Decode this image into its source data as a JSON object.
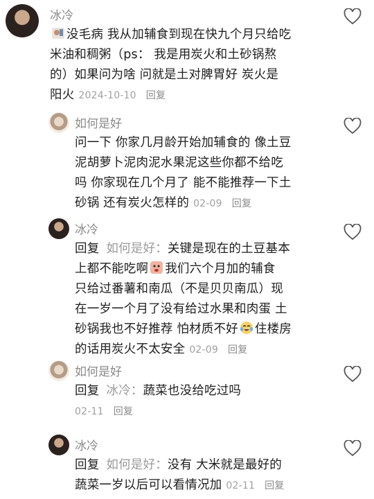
{
  "comments": [
    {
      "user": "冰冷",
      "lines": [
        "没毛病 我从加辅食到现在快九个月只给吃",
        "米油和稠粥（ps： 我是用炭火和土砂锅熬",
        "的）如果问为啥 问就是土对脾胃好 炭火是",
        "阳火"
      ],
      "date": "2024-10-10",
      "reply_label": "回复"
    },
    {
      "user": "如何是好",
      "lines": [
        "问一下 你家几月龄开始加辅食的 像土豆",
        "泥胡萝卜泥肉泥水果泥这些你都不给吃",
        "吗 你家现在几个月了 能不能推荐一下土",
        "砂锅 还有炭火怎样的"
      ],
      "date": "02-09",
      "reply_label": "回复"
    },
    {
      "user": "冰冷",
      "reply_prefix": "回复",
      "mention": "如何是好：",
      "lines": [
        "关键是现在的土豆基本",
        "上都不能吃啊",
        "我们六个月加的辅食",
        "只给过番薯和南瓜（不是贝贝南瓜）现",
        "在一岁一个月了没有给过水果和肉蛋 土",
        "砂锅我也不好推荐 怕材质不好",
        "住楼房",
        "的话用炭火不太安全"
      ],
      "date": "02-09",
      "reply_label": "回复"
    },
    {
      "user": "如何是好",
      "reply_prefix": "回复",
      "mention": "冰冷：",
      "lines": [
        "蔬菜也没给吃过吗"
      ],
      "date": "02-11",
      "reply_label": "回复"
    },
    {
      "user": "冰冷",
      "reply_prefix": "回复",
      "mention": "如何是好：",
      "lines": [
        "没有 大米就是最好的",
        "蔬菜一岁以后可以看情况加"
      ],
      "date": "02-11",
      "reply_label": "回复"
    }
  ],
  "icons": {
    "like": "heart-outline-icon",
    "emoji1": "sticker-icon",
    "emoji2": "crying-face-icon",
    "emoji3": "laughing-tears-icon"
  }
}
